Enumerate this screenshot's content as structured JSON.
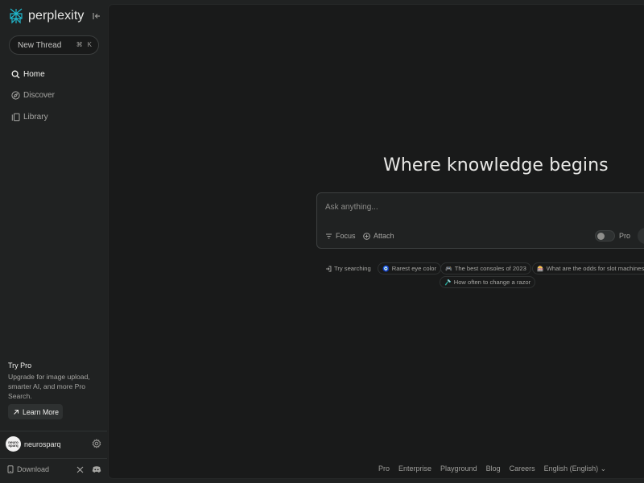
{
  "sidebar": {
    "logo_text": "perplexity",
    "new_thread": {
      "label": "New Thread",
      "shortcut_cmd": "⌘",
      "shortcut_key": "K"
    },
    "nav": [
      {
        "label": "Home",
        "icon": "search-icon",
        "active": true
      },
      {
        "label": "Discover",
        "icon": "compass-icon",
        "active": false
      },
      {
        "label": "Library",
        "icon": "library-icon",
        "active": false
      }
    ],
    "try_pro": {
      "title": "Try Pro",
      "description": "Upgrade for image upload, smarter AI, and more Pro Search.",
      "button": "Learn More"
    },
    "user": {
      "name": "neurosparq",
      "avatar_text": "neuro sparq"
    },
    "download": "Download"
  },
  "main": {
    "headline": "Where knowledge begins",
    "search": {
      "placeholder": "Ask anything...",
      "focus": "Focus",
      "attach": "Attach",
      "pro": "Pro"
    },
    "try_searching": "Try searching",
    "suggestions": [
      {
        "emoji": "🧿",
        "text": "Rarest eye color"
      },
      {
        "emoji": "🎮",
        "text": "The best consoles of 2023"
      },
      {
        "emoji": "🎰",
        "text": "What are the odds for slot machines"
      },
      {
        "emoji": "🪒",
        "text": "How often to change a razor"
      }
    ],
    "footer": [
      "Pro",
      "Enterprise",
      "Playground",
      "Blog",
      "Careers",
      "English (English)"
    ]
  },
  "colors": {
    "sidebar_bg": "#202222",
    "main_bg": "#191a1a",
    "text": "#e8e8e6",
    "muted": "#a6a6a3",
    "accent_logo": "#20b8cd"
  }
}
